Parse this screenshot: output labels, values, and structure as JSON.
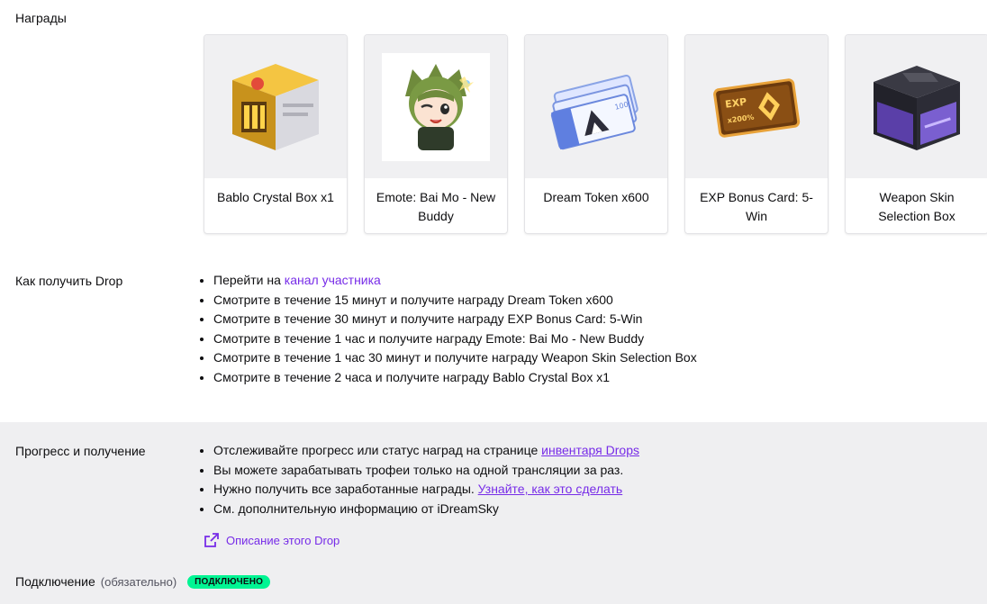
{
  "rewards": {
    "heading": "Награды",
    "items": [
      {
        "name": "Bablo Crystal Box x1",
        "icon": "gold-crystal-box-icon"
      },
      {
        "name": "Emote: Bai Mo - New Buddy",
        "icon": "emote-chibi-character-icon"
      },
      {
        "name": "Dream Token x600",
        "icon": "dream-token-tickets-icon"
      },
      {
        "name": "EXP Bonus Card: 5-Win",
        "icon": "exp-bonus-card-icon"
      },
      {
        "name": "Weapon Skin Selection Box",
        "icon": "weapon-skin-box-icon"
      }
    ]
  },
  "how_to": {
    "heading": "Как получить Drop",
    "go_prefix": "Перейти на ",
    "go_link": "канал участника",
    "steps": [
      "Смотрите в течение 15 минут и получите награду Dream Token x600",
      "Смотрите в течение 30 минут и получите награду EXP Bonus Card: 5-Win",
      "Смотрите в течение 1 час и получите награду Emote: Bai Mo - New Buddy",
      "Смотрите в течение 1 час 30 минут и получите награду Weapon Skin Selection Box",
      "Смотрите в течение 2 часа и получите награду Bablo Crystal Box x1"
    ]
  },
  "progress": {
    "heading": "Прогресс и получение",
    "item1_prefix": "Отслеживайте прогресс или статус наград на странице ",
    "item1_link": "инвентаря Drops",
    "item2": "Вы можете зарабатывать трофеи только на одной трансляции за раз.",
    "item3_prefix": "Нужно получить все заработанные награды. ",
    "item3_link": "Узнайте, как это сделать",
    "item4": "См. дополнительную информацию от iDreamSky",
    "desc_link": "Описание этого Drop"
  },
  "connection": {
    "heading": "Подключение",
    "required": "(обязательно)",
    "status": "ПОДКЛЮЧЕНО"
  },
  "colors": {
    "accent": "#772ce8",
    "badge": "#00f593",
    "band": "#efeff1"
  }
}
